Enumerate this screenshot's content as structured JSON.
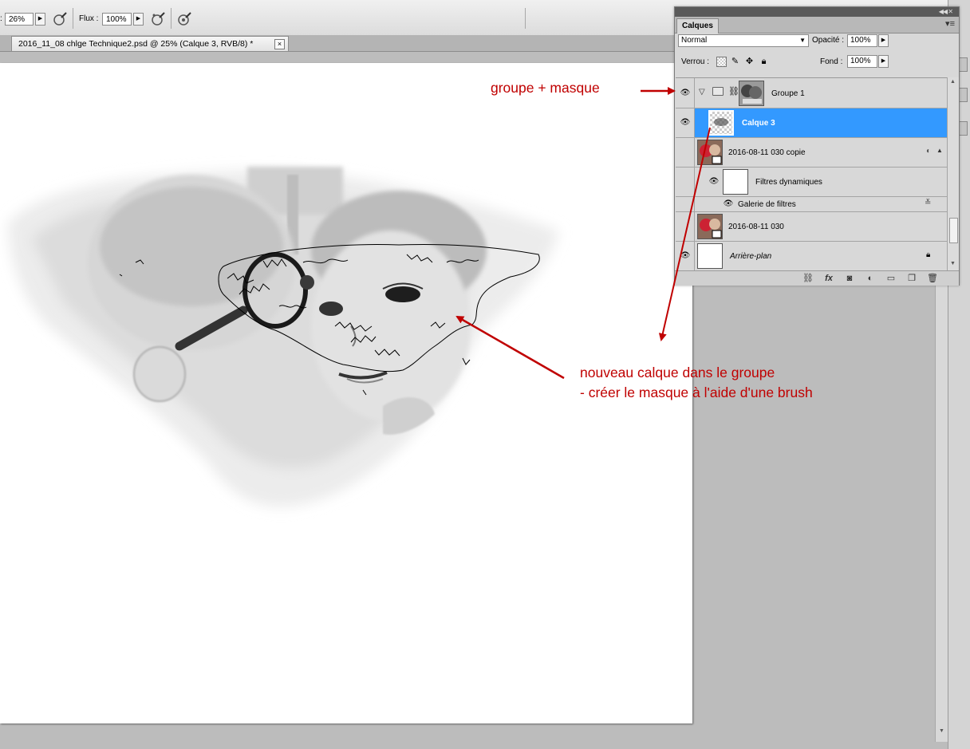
{
  "options_bar": {
    "opacity_value": "26%",
    "flux_label": "Flux :",
    "flux_value": "100%"
  },
  "document_tab": {
    "title": "2016_11_08 chlge Technique2.psd @ 25%  (Calque 3, RVB/8) *"
  },
  "layers_panel": {
    "tab_label": "Calques",
    "blend_mode": "Normal",
    "opacity_label": "Opacité :",
    "opacity_value": "100%",
    "lock_label": "Verrou :",
    "fill_label": "Fond :",
    "fill_value": "100%",
    "layers": [
      {
        "name": "Groupe 1",
        "visible": true,
        "type": "group"
      },
      {
        "name": "Calque 3",
        "visible": true,
        "type": "layer",
        "selected": true
      },
      {
        "name": "2016-08-11 030 copie",
        "visible": false,
        "type": "smart-object"
      },
      {
        "name": "Filtres dynamiques",
        "visible": true,
        "type": "smart-filter-mask"
      },
      {
        "name": "Galerie de filtres",
        "visible": true,
        "type": "smart-filter"
      },
      {
        "name": "2016-08-11 030",
        "visible": false,
        "type": "smart-object"
      },
      {
        "name": "Arrière-plan",
        "visible": true,
        "type": "background",
        "locked": true
      }
    ]
  },
  "annotations": {
    "group_mask": "groupe  + masque",
    "new_layer_line1": "nouveau calque dans le groupe",
    "new_layer_line2": "- créer le masque à l'aide d'une brush"
  },
  "colors": {
    "annotation_red": "#c00000",
    "selection_blue": "#3399ff"
  }
}
